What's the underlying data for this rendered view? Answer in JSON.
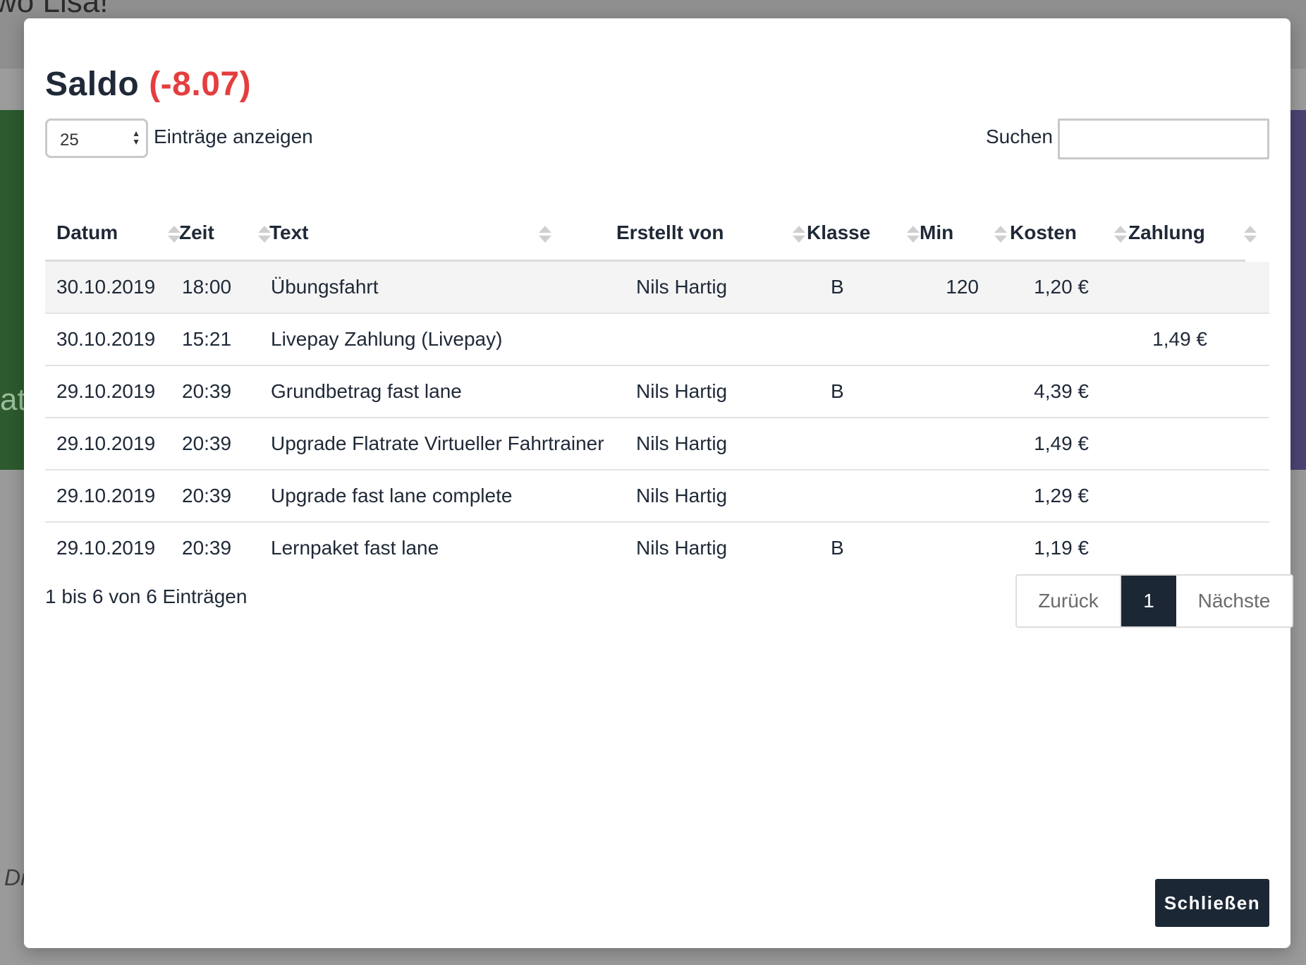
{
  "background": {
    "heading_fragment": "wo Lisa!",
    "side_fragment": "at",
    "bottom_fragment": "Di"
  },
  "modal": {
    "title": "Saldo",
    "balance": "(-8.07)",
    "length": {
      "selected": "25",
      "label": "Einträge anzeigen"
    },
    "search": {
      "label": "Suchen",
      "value": "",
      "placeholder": ""
    },
    "table": {
      "headers": {
        "datum": "Datum",
        "zeit": "Zeit",
        "text": "Text",
        "erstellt_von": "Erstellt von",
        "klasse": "Klasse",
        "min": "Min",
        "kosten": "Kosten",
        "zahlung": "Zahlung"
      },
      "rows": [
        {
          "datum": "30.10.2019",
          "zeit": "18:00",
          "text": "Übungsfahrt",
          "erstellt_von": "Nils Hartig",
          "klasse": "B",
          "min": "120",
          "kosten": "1,20 €",
          "zahlung": ""
        },
        {
          "datum": "30.10.2019",
          "zeit": "15:21",
          "text": "Livepay Zahlung (Livepay)",
          "erstellt_von": "",
          "klasse": "",
          "min": "",
          "kosten": "",
          "zahlung": "1,49 €"
        },
        {
          "datum": "29.10.2019",
          "zeit": "20:39",
          "text": "Grundbetrag fast lane",
          "erstellt_von": "Nils Hartig",
          "klasse": "B",
          "min": "",
          "kosten": "4,39 €",
          "zahlung": ""
        },
        {
          "datum": "29.10.2019",
          "zeit": "20:39",
          "text": "Upgrade Flatrate Virtueller Fahrtrainer",
          "erstellt_von": "Nils Hartig",
          "klasse": "",
          "min": "",
          "kosten": "1,49 €",
          "zahlung": ""
        },
        {
          "datum": "29.10.2019",
          "zeit": "20:39",
          "text": "Upgrade fast lane complete",
          "erstellt_von": "Nils Hartig",
          "klasse": "",
          "min": "",
          "kosten": "1,29 €",
          "zahlung": ""
        },
        {
          "datum": "29.10.2019",
          "zeit": "20:39",
          "text": "Lernpaket fast lane",
          "erstellt_von": "Nils Hartig",
          "klasse": "B",
          "min": "",
          "kosten": "1,19 €",
          "zahlung": ""
        }
      ]
    },
    "info": "1 bis 6 von 6 Einträgen",
    "pagination": {
      "prev": "Zurück",
      "current": "1",
      "next": "Nächste"
    },
    "close_label": "Schließen"
  },
  "colors": {
    "balance_negative": "#e53e3e",
    "primary_dark": "#1c2736",
    "border": "#dcdcdc"
  }
}
